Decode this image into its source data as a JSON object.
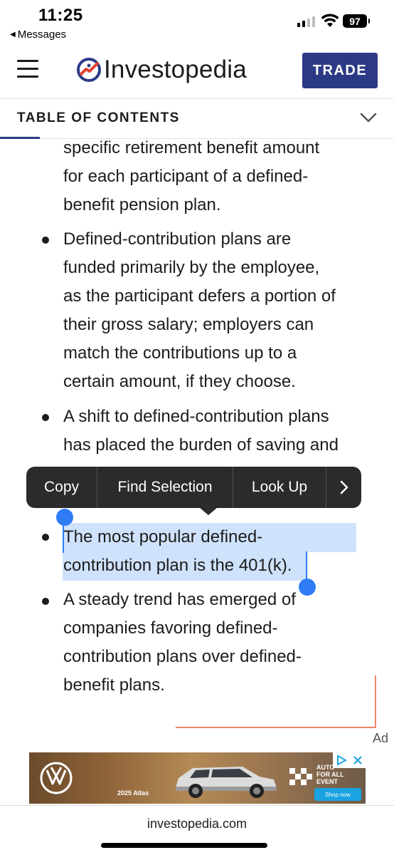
{
  "status_bar": {
    "time": "11:25",
    "back_app": "Messages",
    "battery": "97"
  },
  "header": {
    "logo_text": "Investopedia",
    "trade_label": "TRADE"
  },
  "toc": {
    "label": "TABLE OF CONTENTS"
  },
  "article": {
    "lines": [
      {
        "text": "specific retirement benefit amount"
      },
      {
        "text": "for each participant of a defined-"
      },
      {
        "text": "benefit pension plan."
      },
      {
        "text": "Defined-contribution plans are"
      },
      {
        "text": "funded primarily by the employee,"
      },
      {
        "text": "as the participant defers a portion of"
      },
      {
        "text": "their gross salary; employers can"
      },
      {
        "text": "match the contributions up to a"
      },
      {
        "text": "certain amount, if they choose."
      },
      {
        "text": "A shift to defined-contribution plans"
      },
      {
        "text": "has placed the burden of saving and"
      },
      {
        "text": "The most popular defined-"
      },
      {
        "text": "contribution plan is the 401(k)."
      },
      {
        "text": "A steady trend has emerged of"
      },
      {
        "text": "companies favoring defined-"
      },
      {
        "text": "contribution plans over defined-"
      },
      {
        "text": "benefit plans."
      }
    ]
  },
  "context_menu": {
    "copy": "Copy",
    "find_selection": "Find Selection",
    "look_up": "Look Up",
    "more": "›"
  },
  "ad": {
    "label": "Ad",
    "car_name": "2025 Atlas",
    "tag_text": "AUTO FOR ALL EVENT",
    "shop_now": "Shop now"
  },
  "browser": {
    "url": "investopedia.com"
  },
  "colors": {
    "brand_navy": "#2c3a86",
    "selection_blue": "#2f7cf6",
    "selection_highlight": "#cfe2fb",
    "ad_marker": "#f08468"
  }
}
